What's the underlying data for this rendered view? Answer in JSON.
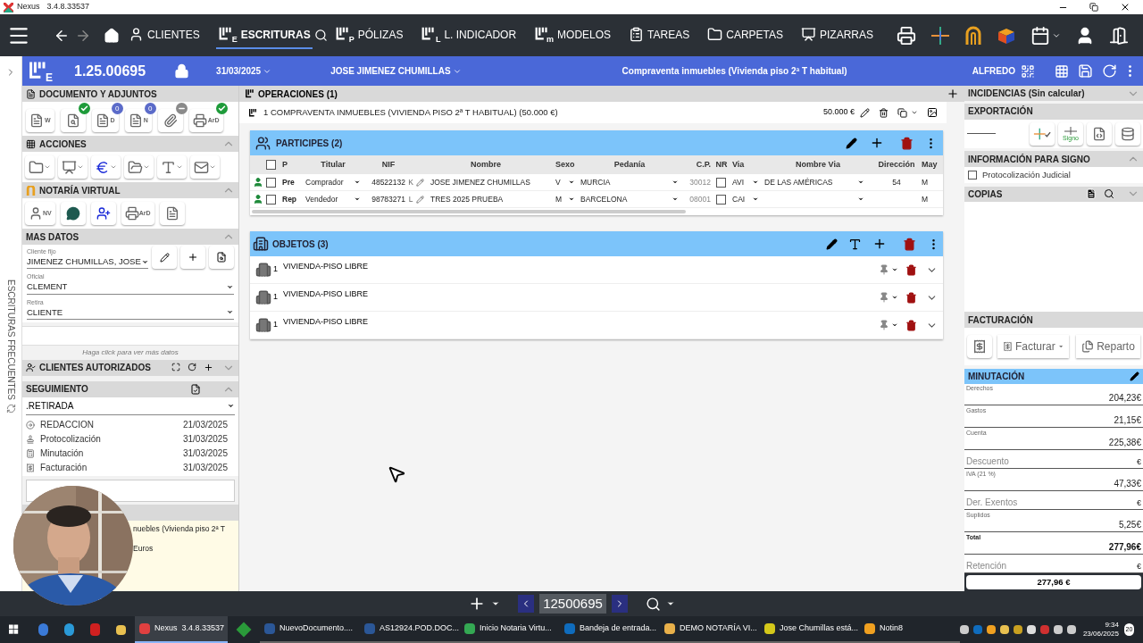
{
  "window": {
    "title": "Nexus",
    "version": "3.4.8.33537"
  },
  "nav": {
    "items": [
      {
        "label": "CLIENTES",
        "selected": false
      },
      {
        "label": "ESCRITURAS",
        "letter": "E",
        "selected": true
      },
      {
        "label": "PÓLIZAS",
        "letter": "P",
        "selected": false
      },
      {
        "label": "L. INDICADOR",
        "letter": "L",
        "selected": false
      },
      {
        "label": "MODELOS",
        "letter": "m",
        "selected": false
      },
      {
        "label": "TAREAS",
        "selected": false
      },
      {
        "label": "CARPETAS",
        "selected": false
      },
      {
        "label": "PIZARRAS",
        "selected": false
      }
    ]
  },
  "header": {
    "logo_letter": "E",
    "number": "1.25.00695",
    "date": "31/03/2025",
    "client": "JOSE JIMENEZ CHUMILLAS",
    "title": "Compraventa inmuebles (Vivienda piso 2ª T habitual)",
    "user": "ALFREDO"
  },
  "side_tab": {
    "label": "ESCRITURAS FRECUENTES"
  },
  "documento": {
    "title": "DOCUMENTO Y ADJUNTOS",
    "tools": [
      {
        "letter": "W"
      },
      {
        "badge": {
          "kind": "check"
        }
      },
      {
        "letter": "D",
        "badge": {
          "kind": "count",
          "text": "0"
        }
      },
      {
        "letter": "N",
        "badge": {
          "kind": "count",
          "text": "0"
        }
      },
      {
        "badge": {
          "kind": "minus"
        }
      },
      {
        "letter": "ArD",
        "badge": {
          "kind": "check"
        }
      }
    ]
  },
  "acciones": {
    "title": "ACCIONES",
    "expanded": true
  },
  "notaria": {
    "title": "NOTARÍA VIRTUAL",
    "expanded": true,
    "tools": [
      {
        "kind": "person",
        "letter": "NV"
      },
      {
        "kind": "chat"
      },
      {
        "kind": "send"
      },
      {
        "kind": "scanner",
        "letter": "ArD"
      },
      {
        "kind": "form"
      }
    ]
  },
  "mas_datos": {
    "title": "MAS DATOS",
    "expanded": true,
    "fields": [
      {
        "label": "Cliente fijo",
        "value": "JIMENEZ CHUMILLAS, JOSE"
      },
      {
        "label": "Oficial",
        "value": "CLEMENT"
      },
      {
        "label": "Retira",
        "value": "CLIENTE"
      }
    ],
    "hint": "Haga click para ver más datos"
  },
  "clientes_autorizados": {
    "title": "CLIENTES AUTORIZADOS",
    "expanded": false
  },
  "seguimiento": {
    "title": "SEGUIMIENTO",
    "expanded": true,
    "estado": ".RETIRADA",
    "items": [
      {
        "label": "REDACCION",
        "date": "21/03/2025"
      },
      {
        "label": "Protocolización",
        "date": "31/03/2025"
      },
      {
        "label": "Minutación",
        "date": "31/03/2025"
      },
      {
        "label": "Facturación",
        "date": "31/03/2025"
      }
    ],
    "lines": [
      "nuebles (Vivienda piso 2ª T",
      "Euros"
    ]
  },
  "operaciones": {
    "title": "OPERACIONES (1)",
    "items": [
      {
        "label": "1 COMPRAVENTA INMUEBLES (VIVIENDA PISO 2ª T HABITUAL) (50.000 €)",
        "amount": "50.000 €"
      }
    ]
  },
  "participes": {
    "title": "PARTICIPES (2)",
    "all_checked": false,
    "columns": [
      "P",
      "Titular",
      "NIF",
      "Nombre",
      "Sexo",
      "Pedanía",
      "C.P.",
      "NR",
      "Via",
      "Nombre Via",
      "Dirección",
      "May"
    ],
    "rows": [
      {
        "checked": false,
        "p": "Pre",
        "titular": "Comprador",
        "nif": "48522132",
        "letra": "K",
        "nombre": "JOSE JIMENEZ CHUMILLAS",
        "sexo": "V",
        "pedania": "MURCIA",
        "cp": "30012",
        "nr": false,
        "via": "AVI",
        "nombre_via": "DE LAS AMÉRICAS",
        "direccion": "54",
        "may": "M"
      },
      {
        "checked": false,
        "p": "Rep",
        "titular": "Vendedor",
        "nif": "98783271",
        "letra": "L",
        "nombre": "TRES 2025 PRUEBA",
        "sexo": "M",
        "pedania": "BARCELONA",
        "cp": "08001",
        "nr": false,
        "via": "CAI",
        "may": "M"
      }
    ]
  },
  "objetos": {
    "title": "OBJETOS (3)",
    "items": [
      {
        "count": "1",
        "label": "VIVIENDA-PISO LIBRE"
      },
      {
        "count": "1",
        "label": "VIVIENDA-PISO LIBRE"
      },
      {
        "count": "1",
        "label": "VIVIENDA-PISO LIBRE"
      }
    ]
  },
  "incidencias": {
    "title": "INCIDENCIAS (Sin calcular)",
    "expanded": false
  },
  "exportacion": {
    "title": "EXPORTACIÓN",
    "signo": "Signo"
  },
  "info_signo": {
    "title": "INFORMACIÓN PARA SIGNO",
    "expanded": true,
    "options": [
      {
        "label": "Protocolización Judicial",
        "checked": false
      }
    ]
  },
  "copias": {
    "title": "COPIAS",
    "expanded": false
  },
  "facturacion": {
    "title": "FACTURACIÓN",
    "buttons": [
      "Facturar",
      "Reparto"
    ]
  },
  "minutacion": {
    "title": "MINUTACIÓN",
    "fields": [
      {
        "kind": "stacked",
        "label": "Derechos",
        "value": "204,23€"
      },
      {
        "kind": "stacked",
        "label": "Gastos",
        "value": "21,15€"
      },
      {
        "kind": "stacked",
        "label": "Cuenta",
        "value": "225,38€"
      },
      {
        "kind": "inline",
        "label": "Descuento",
        "value": "€"
      },
      {
        "kind": "stacked",
        "label": "IVA (21 %)",
        "value": "47,33€"
      },
      {
        "kind": "inline",
        "label": "Der. Exentos",
        "value": "€"
      },
      {
        "kind": "stacked",
        "label": "Suplidos",
        "value": "5,25€"
      },
      {
        "kind": "total",
        "label": "Total",
        "value": "277,96€"
      },
      {
        "kind": "inline",
        "label": "Retención",
        "value": "€"
      }
    ],
    "total": "277,96 €"
  },
  "bottom_bar": {
    "record": "12500695"
  },
  "taskbar": {
    "apps": [
      {
        "label": "Nexus  3.4.8.33537",
        "selected": true,
        "color": "#e04040"
      },
      {
        "label": "NuevoDocumento....",
        "selected": false,
        "color": "#2b5797"
      },
      {
        "label": "AS12924.POD.DOC...",
        "selected": false,
        "color": "#2b5797"
      },
      {
        "label": "Inicio Notaria Virtu...",
        "selected": false,
        "color": "#34a853"
      },
      {
        "label": "Bandeja de entrada...",
        "selected": false,
        "color": "#0f6cbd"
      },
      {
        "label": "DEMO NOTARÍA VI...",
        "selected": false,
        "color": "#e8b04a"
      },
      {
        "label": "Jose Chumillas está...",
        "selected": false,
        "color": "#d4c81a"
      },
      {
        "label": "Notin8",
        "selected": false,
        "color": "#f0a020"
      }
    ],
    "time": "9:34",
    "date": "23/06/2025",
    "notifications": "20"
  }
}
